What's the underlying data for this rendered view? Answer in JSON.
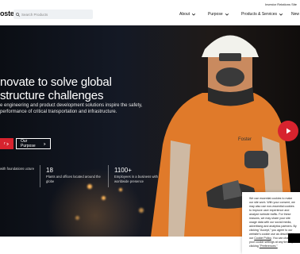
{
  "topbar": {
    "logo": "oster",
    "investor_link": "Investor Relations Site",
    "search": {
      "placeholder": "Search Products",
      "value": ""
    },
    "nav": [
      {
        "label": "About"
      },
      {
        "label": "Purpose"
      },
      {
        "label": "Products & Services"
      },
      {
        "label": "New"
      }
    ]
  },
  "hero": {
    "headline": "novate to solve global structure challenges",
    "subtext": "e engineering and product development solutions inspire the safety, performance of critical transportation and infrastructure.",
    "primary_button_label": "r",
    "secondary_button_label": "Our Purpose",
    "stats": [
      {
        "number": "",
        "label": "with foundations ucture"
      },
      {
        "number": "18",
        "label": "Plants and offices located around the globe"
      },
      {
        "number": "1100+",
        "label": "Employees in a business with worldwide presence"
      }
    ],
    "vest_text": "Foster"
  },
  "cookie": {
    "text": "We use essential cookies to make our site work. With your consent, we may also use non-essential cookies to improve user experience and analyze website traffic. For these reasons, we may share your site usage data with our social media, advertising and analytics partners. By clicking \"Accept,\" you agree to our website's cookie use as described in our",
    "policy_link": "Cookie Policy",
    "text_after": ". You can change your cookie settings at any time by clicking",
    "prefs_link": "\"Preferences.\""
  },
  "colors": {
    "accent": "#d7232e",
    "hero_dark": "#141925",
    "search_bg": "#eef1f4"
  }
}
